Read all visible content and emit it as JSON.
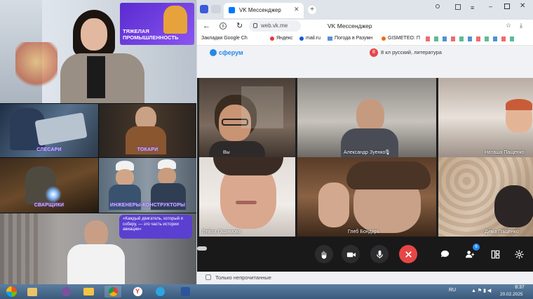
{
  "left_video": {
    "banner": "ТЯЖЕЛАЯ ПРОМЫШЛЕННОСТЬ",
    "captions": [
      "СЛЕСАРИ",
      "ТОКАРИ",
      "СВАРЩИКИ",
      "ИНЖЕНЕРЫ-КОНСТРУКТОРЫ"
    ],
    "quote": "«Каждый двигатель, который я соберу, — это часть истории авиации»"
  },
  "browser": {
    "tab_title": "VK Мессенджер",
    "window_title": "VK Мессенджер",
    "address": "web.vk.me",
    "bookmarks": [
      "Закладки Google Ch",
      "Яндекс",
      "mail.ru",
      "Погода в Разумн",
      "GISMETEO: П"
    ]
  },
  "vk": {
    "logo": "сферум",
    "chat_title": "8 кл русский, литература",
    "filter_label": "Только непрочитанные"
  },
  "call": {
    "participants": [
      {
        "name": "Вы",
        "muted": false
      },
      {
        "name": "Александр Зуенко",
        "muted": true
      },
      {
        "name": "Наташа Пащенко",
        "muted": true
      },
      {
        "name": "Лейла Гашимова",
        "muted": true
      },
      {
        "name": "Глеб Бондарь",
        "muted": true
      },
      {
        "name": "Дима Пащенко",
        "muted": true
      }
    ],
    "participants_badge": "6",
    "colors": {
      "end_call": "#e64646",
      "bar": "#19191a",
      "accent": "#2688eb"
    }
  },
  "taskbar": {
    "lang": "RU",
    "time": "8:37",
    "date": "20.02.2025"
  }
}
